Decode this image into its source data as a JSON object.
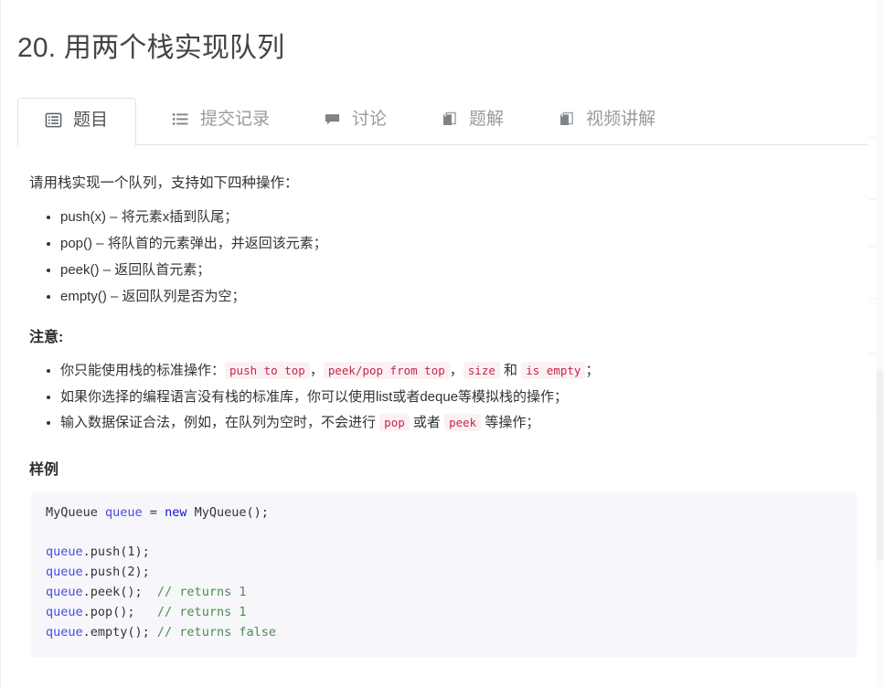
{
  "header": {
    "title": "20. 用两个栈实现队列"
  },
  "tabs": [
    {
      "id": "problem",
      "label": "题目",
      "icon": "list-alt-icon",
      "active": true
    },
    {
      "id": "submissions",
      "label": "提交记录",
      "icon": "list-icon",
      "active": false
    },
    {
      "id": "discussion",
      "label": "讨论",
      "icon": "comment-icon",
      "active": false
    },
    {
      "id": "solution",
      "label": "题解",
      "icon": "book-icon",
      "active": false
    },
    {
      "id": "video",
      "label": "视频讲解",
      "icon": "book-icon",
      "active": false
    }
  ],
  "content": {
    "lead": "请用栈实现一个队列，支持如下四种操作：",
    "operations": [
      "push(x) – 将元素x插到队尾；",
      "pop() – 将队首的元素弹出，并返回该元素；",
      "peek() – 返回队首元素；",
      "empty() – 返回队列是否为空；"
    ],
    "notes_heading": "注意:",
    "notes": [
      {
        "parts": [
          {
            "t": "text",
            "v": "你只能使用栈的标准操作："
          },
          {
            "t": "code",
            "v": "push to top"
          },
          {
            "t": "text",
            "v": "，"
          },
          {
            "t": "code",
            "v": "peek/pop from top"
          },
          {
            "t": "text",
            "v": "，"
          },
          {
            "t": "code",
            "v": "size"
          },
          {
            "t": "text",
            "v": " 和 "
          },
          {
            "t": "code",
            "v": "is empty"
          },
          {
            "t": "text",
            "v": "；"
          }
        ]
      },
      {
        "parts": [
          {
            "t": "text",
            "v": "如果你选择的编程语言没有栈的标准库，你可以使用list或者deque等模拟栈的操作；"
          }
        ]
      },
      {
        "parts": [
          {
            "t": "text",
            "v": "输入数据保证合法，例如，在队列为空时，不会进行 "
          },
          {
            "t": "code",
            "v": "pop"
          },
          {
            "t": "text",
            "v": " 或者 "
          },
          {
            "t": "code",
            "v": "peek"
          },
          {
            "t": "text",
            "v": " 等操作；"
          }
        ]
      }
    ],
    "sample_heading": "样例",
    "code_lines": [
      [
        {
          "cls": "tok-type",
          "v": "MyQueue "
        },
        {
          "cls": "tok-var",
          "v": "queue"
        },
        {
          "cls": "tok-plain",
          "v": " = "
        },
        {
          "cls": "tok-kw",
          "v": "new"
        },
        {
          "cls": "tok-plain",
          "v": " MyQueue();"
        }
      ],
      [],
      [
        {
          "cls": "tok-var",
          "v": "queue"
        },
        {
          "cls": "tok-plain",
          "v": ".push(1);"
        }
      ],
      [
        {
          "cls": "tok-var",
          "v": "queue"
        },
        {
          "cls": "tok-plain",
          "v": ".push(2);"
        }
      ],
      [
        {
          "cls": "tok-var",
          "v": "queue"
        },
        {
          "cls": "tok-plain",
          "v": ".peek();  "
        },
        {
          "cls": "tok-comment",
          "v": "// returns 1"
        }
      ],
      [
        {
          "cls": "tok-var",
          "v": "queue"
        },
        {
          "cls": "tok-plain",
          "v": ".pop();   "
        },
        {
          "cls": "tok-comment",
          "v": "// returns 1"
        }
      ],
      [
        {
          "cls": "tok-var",
          "v": "queue"
        },
        {
          "cls": "tok-plain",
          "v": ".empty(); "
        },
        {
          "cls": "tok-comment",
          "v": "// returns false"
        }
      ]
    ]
  },
  "colors": {
    "title": "#444444",
    "tab_active_text": "#555555",
    "tab_inactive_text": "#9a9a9a",
    "inline_code_text": "#c7254e",
    "inline_code_bg": "#fbf1f3",
    "code_block_bg": "#f7f7fb",
    "code_keyword": "#1414cc",
    "code_variable": "#4a4ae0",
    "code_comment": "#4d8a4d",
    "border": "#e2e2e2"
  }
}
